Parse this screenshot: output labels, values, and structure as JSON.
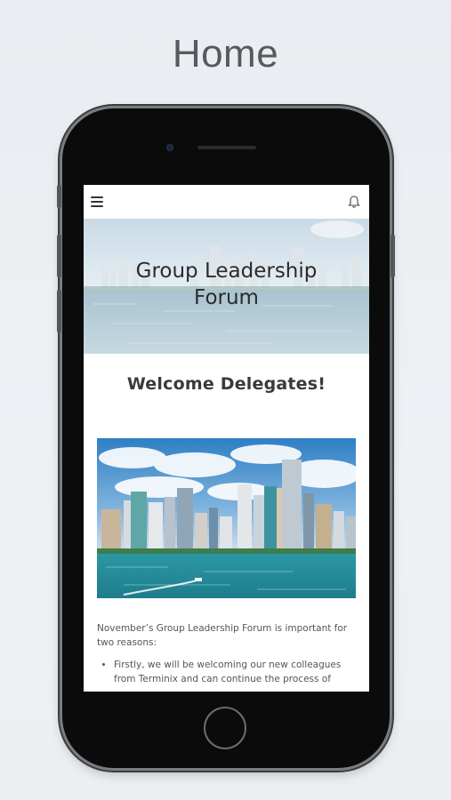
{
  "page_heading": "Home",
  "app": {
    "menu_icon": "hamburger-menu-icon",
    "notification_icon": "bell-icon"
  },
  "hero": {
    "title_line1": "Group Leadership",
    "title_line2": "Forum"
  },
  "welcome_heading": "Welcome Delegates!",
  "intro": {
    "paragraph": "November’s Group Leadership Forum is important for two reasons:",
    "bullets": [
      "Firstly, we will be welcoming our new colleagues from Terminix and can continue the process of"
    ]
  },
  "colors": {
    "background": "#e9edf1",
    "phone_body": "#0b0b0c",
    "heading_text": "#555a5f",
    "body_text": "#555555",
    "water": "#2fa0ad"
  }
}
